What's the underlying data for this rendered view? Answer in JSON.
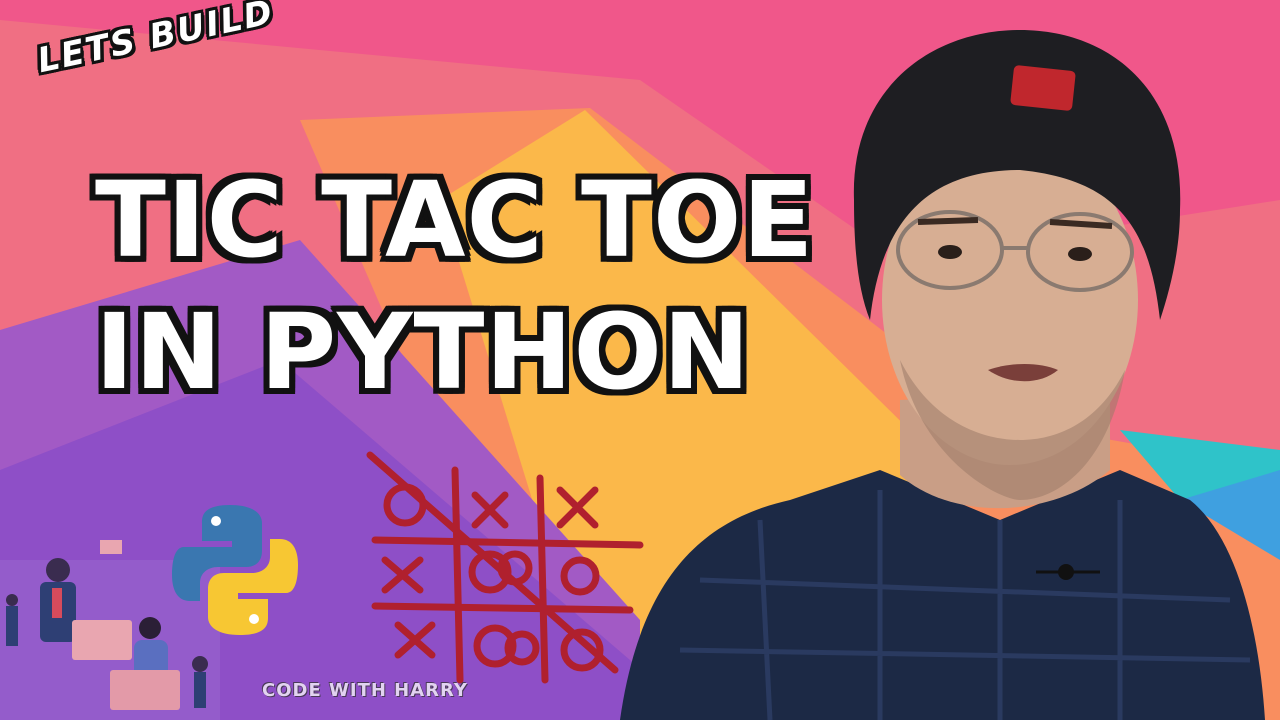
{
  "kicker": "LETS BUILD",
  "headline": {
    "line1": "TIC TAC TOE",
    "line2": "IN PYTHON"
  },
  "watermark": "CODE WITH HARRY",
  "colors": {
    "pink": "#f0578a",
    "orange": "#f98e5f",
    "yellow": "#fbb84a",
    "purple": "#a25ac5",
    "violet": "#8e4fc7",
    "teal": "#2fc3c9",
    "ink_red": "#b0202e"
  },
  "icons": [
    "python-logo-icon",
    "tic-tac-toe-sketch",
    "office-illustration",
    "person-photo"
  ]
}
